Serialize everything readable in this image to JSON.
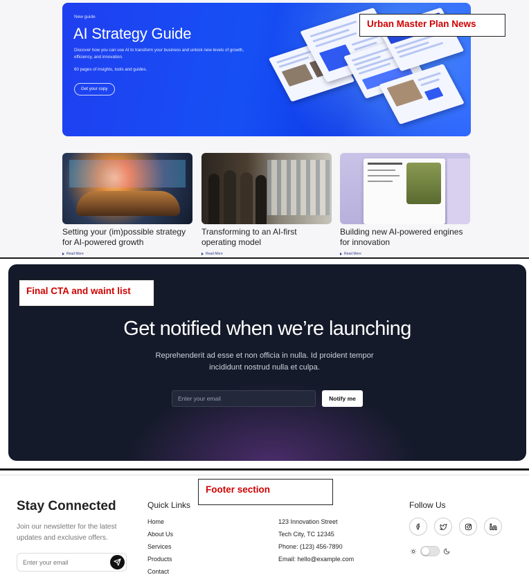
{
  "labels": {
    "news": "Urban Master Plan News",
    "cta": "Final CTA and waint list",
    "footer": "Footer section"
  },
  "hero": {
    "eyebrow": "New guide",
    "title": "AI Strategy Guide",
    "description": "Discover how you can use AI to transform your business and unlock new levels of growth, efficiency, and innovation.",
    "pages": "60 pages of insights, tools and guides.",
    "button": "Get your copy"
  },
  "cards": [
    {
      "title": "Setting your (im)possible strategy for AI-powered growth",
      "link": "Read More"
    },
    {
      "title": "Transforming to an AI-first operating model",
      "link": "Read More"
    },
    {
      "title": "Building new AI-powered engines for innovation",
      "link": "Read More"
    }
  ],
  "cta": {
    "title": "Get notified when we’re launching",
    "subtitle": "Reprehenderit ad esse et non officia in nulla. Id proident tempor incididunt nostrud nulla et culpa.",
    "input_placeholder": "Enter your email",
    "button": "Notify me"
  },
  "footer": {
    "title": "Stay Connected",
    "description": "Join our newsletter for the latest updates and exclusive offers.",
    "input_placeholder": "Enter your email",
    "quick_links": {
      "heading": "Quick Links",
      "items": [
        "Home",
        "About Us",
        "Services",
        "Products",
        "Contact"
      ]
    },
    "contact": {
      "items": [
        "123 Innovation Street",
        "Tech City, TC 12345",
        "Phone: (123) 456-7890",
        "Email: hello@example.com"
      ]
    },
    "follow": {
      "heading": "Follow Us",
      "icons": [
        "facebook-icon",
        "twitter-icon",
        "instagram-icon",
        "linkedin-icon"
      ]
    }
  },
  "colors": {
    "hero_blue": "#1650f5",
    "cta_bg": "#151a2a",
    "label_red": "#d00000"
  }
}
